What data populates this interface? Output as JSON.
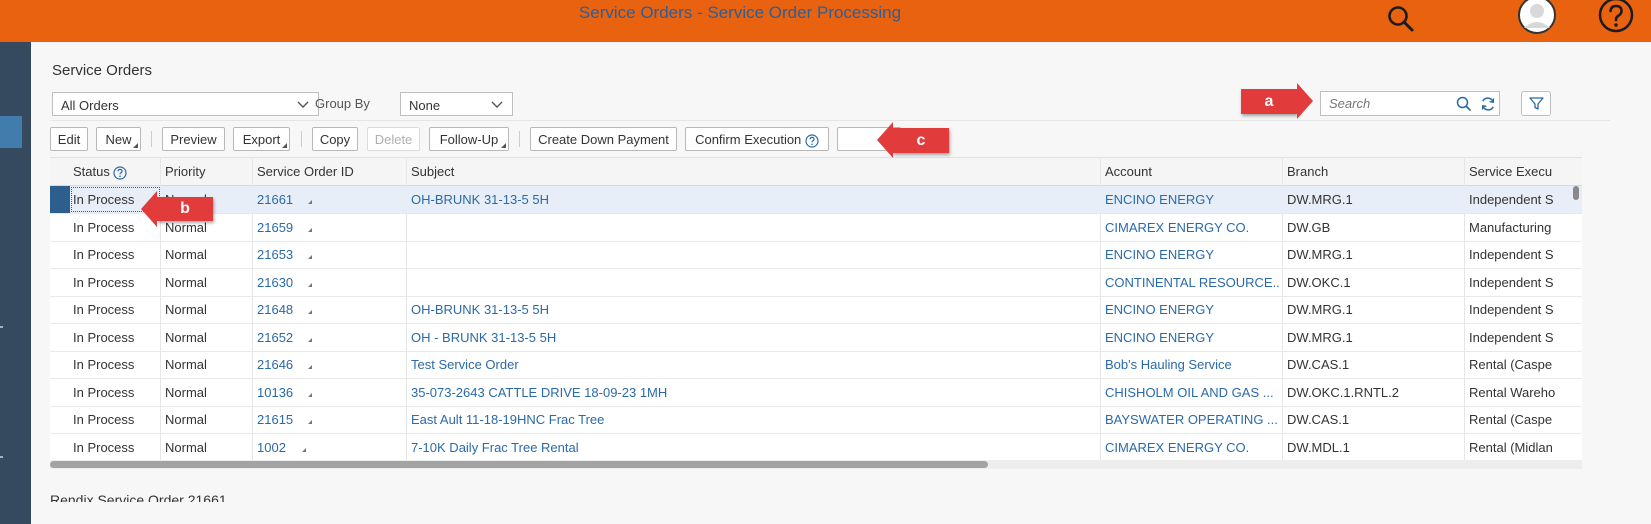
{
  "header": {
    "title": "Service Orders - Service Order Processing"
  },
  "page": {
    "title": "Service Orders"
  },
  "filters": {
    "view_select": "All Orders",
    "group_by_label": "Group By",
    "group_by_value": "None",
    "search_placeholder": "Search"
  },
  "toolbar": {
    "edit": "Edit",
    "new": "New",
    "preview": "Preview",
    "export": "Export",
    "copy": "Copy",
    "delete": "Delete",
    "follow_up": "Follow-Up",
    "create_down_payment": "Create Down Payment",
    "confirm_execution": "Confirm Execution"
  },
  "table": {
    "columns": [
      "Status",
      "Priority",
      "Service Order ID",
      "Subject",
      "Account",
      "Branch",
      "Service Execu"
    ],
    "rows": [
      {
        "status": "In Process",
        "priority": "Normal",
        "id": "21661",
        "subject": "OH-BRUNK 31-13-5 5H",
        "account": "ENCINO ENERGY",
        "branch": "DW.MRG.1",
        "execution": "Independent S"
      },
      {
        "status": "In Process",
        "priority": "Normal",
        "id": "21659",
        "subject": "",
        "account": "CIMAREX ENERGY CO.",
        "branch": "DW.GB",
        "execution": "Manufacturing"
      },
      {
        "status": "In Process",
        "priority": "Normal",
        "id": "21653",
        "subject": "",
        "account": "ENCINO ENERGY",
        "branch": "DW.MRG.1",
        "execution": "Independent S"
      },
      {
        "status": "In Process",
        "priority": "Normal",
        "id": "21630",
        "subject": "",
        "account": "CONTINENTAL RESOURCE...",
        "branch": "DW.OKC.1",
        "execution": "Independent S"
      },
      {
        "status": "In Process",
        "priority": "Normal",
        "id": "21648",
        "subject": "OH-BRUNK 31-13-5 5H",
        "account": "ENCINO ENERGY",
        "branch": "DW.MRG.1",
        "execution": "Independent S"
      },
      {
        "status": "In Process",
        "priority": "Normal",
        "id": "21652",
        "subject": "OH - BRUNK 31-13-5 5H",
        "account": "ENCINO ENERGY",
        "branch": "DW.MRG.1",
        "execution": "Independent S"
      },
      {
        "status": "In Process",
        "priority": "Normal",
        "id": "21646",
        "subject": "Test Service Order",
        "account": "Bob's Hauling Service",
        "branch": "DW.CAS.1",
        "execution": "Rental (Caspe"
      },
      {
        "status": "In Process",
        "priority": "Normal",
        "id": "10136",
        "subject": "35-073-2643 CATTLE DRIVE 18-09-23 1MH",
        "account": "CHISHOLM OIL AND GAS ...",
        "branch": "DW.OKC.1.RNTL.2",
        "execution": "Rental Wareho"
      },
      {
        "status": "In Process",
        "priority": "Normal",
        "id": "21615",
        "subject": "East Ault 11-18-19HNC Frac Tree",
        "account": "BAYSWATER OPERATING ...",
        "branch": "DW.CAS.1",
        "execution": "Rental (Caspe"
      },
      {
        "status": "In Process",
        "priority": "Normal",
        "id": "1002",
        "subject": "7-10K Daily Frac Tree Rental",
        "account": "CIMAREX ENERGY CO.",
        "branch": "DW.MDL.1",
        "execution": "Rental (Midlan"
      }
    ]
  },
  "bottom": {
    "section_title": "Rendix Service Order 21661"
  },
  "annotations": {
    "a": "a",
    "b": "b",
    "c": "c"
  },
  "colors": {
    "header": "#e8620f",
    "link": "#2a6aa8",
    "callout": "#e23b3b",
    "sidebar": "#354a5f"
  }
}
